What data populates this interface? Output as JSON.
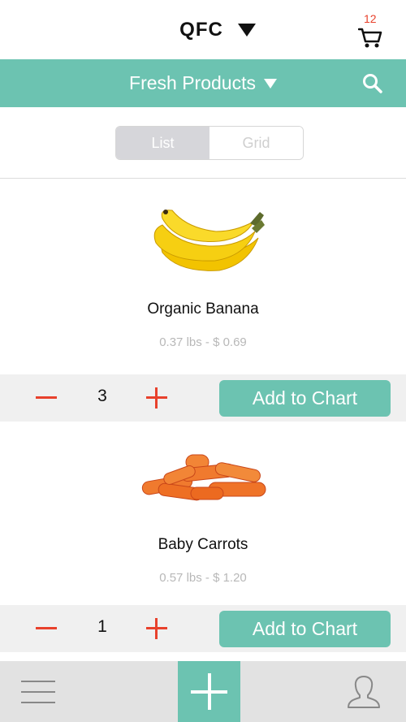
{
  "header": {
    "store_name": "QFC",
    "cart_count": "12"
  },
  "category_bar": {
    "label": "Fresh Products"
  },
  "view_toggle": {
    "list_label": "List",
    "grid_label": "Grid",
    "selected": "List"
  },
  "colors": {
    "accent": "#6cc3b1",
    "danger": "#e8412c",
    "muted_text": "#b8b8b8",
    "action_bar_bg": "#f0f0f0"
  },
  "products": [
    {
      "name": "Organic Banana",
      "meta": "0.37 lbs - $ 0.69",
      "quantity": "3",
      "add_label": "Add to Chart",
      "image": "banana-image"
    },
    {
      "name": "Baby Carrots",
      "meta": "0.57 lbs - $ 1.20",
      "quantity": "1",
      "add_label": "Add to Chart",
      "image": "carrots-image"
    }
  ],
  "tabbar": {
    "icons": [
      "menu-icon",
      "plus-icon",
      "profile-icon"
    ]
  }
}
